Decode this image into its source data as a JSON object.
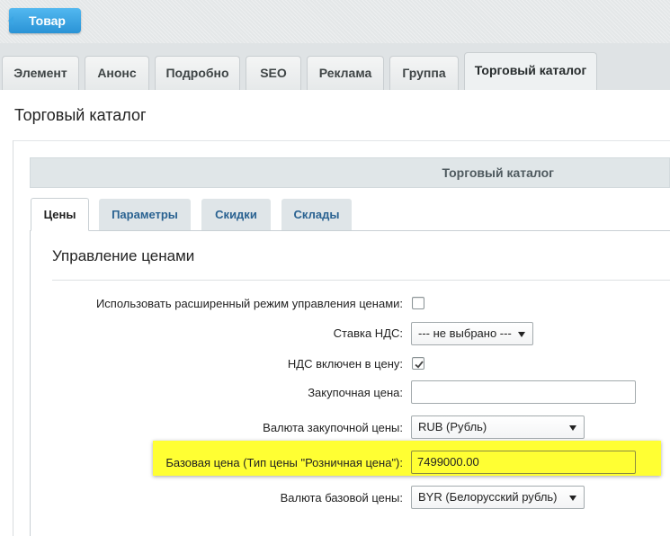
{
  "header": {
    "back_button_label": "Товар"
  },
  "main_tabs": [
    {
      "label": "Элемент"
    },
    {
      "label": "Анонс"
    },
    {
      "label": "Подробно"
    },
    {
      "label": "SEO"
    },
    {
      "label": "Реклама"
    },
    {
      "label": "Группа"
    },
    {
      "label": "Торговый каталог"
    }
  ],
  "active_main_tab": "Торговый каталог",
  "page_title": "Торговый каталог",
  "section_header": "Торговый каталог",
  "sub_tabs": [
    {
      "label": "Цены"
    },
    {
      "label": "Параметры"
    },
    {
      "label": "Скидки"
    },
    {
      "label": "Склады"
    }
  ],
  "active_sub_tab": "Цены",
  "content": {
    "title": "Управление ценами",
    "extended_mode": {
      "label": "Использовать расширенный режим управления ценами:",
      "checked": false
    },
    "vat_rate": {
      "label": "Ставка НДС:",
      "value": "--- не выбрано ---"
    },
    "vat_included": {
      "label": "НДС включен в цену:",
      "checked": true
    },
    "purchase_price": {
      "label": "Закупочная цена:",
      "value": ""
    },
    "purchase_currency": {
      "label": "Валюта закупочной цены:",
      "value": "RUB (Рубль)"
    },
    "base_price": {
      "label": "Базовая цена (Тип цены \"Розничная цена\"):",
      "value": "7499000.00"
    },
    "base_currency": {
      "label": "Валюта базовой цены:",
      "value": "BYR (Белорусский рубль)"
    }
  },
  "colors": {
    "accent_blue": "#2a93d6",
    "highlight_yellow": "#ffff33",
    "sub_tab_link": "#2a6291"
  }
}
